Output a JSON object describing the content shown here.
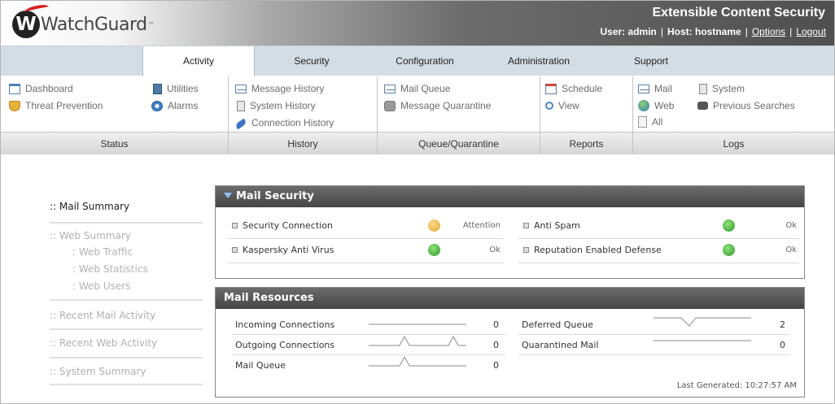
{
  "header": {
    "logo_text": "WatchGuard",
    "logo_tm": "™",
    "product": "Extensible Content Security",
    "user_label": "User:",
    "user": "admin",
    "host_label": "Host:",
    "host": "hostname",
    "options": "Options",
    "logout": "Logout",
    "separator": "|"
  },
  "tabs": [
    "Activity",
    "Security",
    "Configuration",
    "Administration",
    "Support"
  ],
  "active_tab": "Activity",
  "submenu": {
    "status": {
      "name": "Status",
      "items": [
        {
          "label": "Dashboard",
          "icon": "dashboard-icon"
        },
        {
          "label": "Threat Prevention",
          "icon": "shield-icon"
        },
        {
          "label": "Utilities",
          "icon": "utilities-icon"
        },
        {
          "label": "Alarms",
          "icon": "alarm-icon"
        }
      ]
    },
    "history": {
      "name": "History",
      "items": [
        {
          "label": "Message History",
          "icon": "envelope-icon"
        },
        {
          "label": "System History",
          "icon": "document-icon"
        },
        {
          "label": "Connection History",
          "icon": "plug-icon"
        }
      ]
    },
    "queue": {
      "name": "Queue/Quarantine",
      "items": [
        {
          "label": "Mail Queue",
          "icon": "envelope-icon"
        },
        {
          "label": "Message Quarantine",
          "icon": "lock-icon"
        }
      ]
    },
    "reports": {
      "name": "Reports",
      "items": [
        {
          "label": "Schedule",
          "icon": "calendar-icon"
        },
        {
          "label": "View",
          "icon": "magnifier-icon"
        }
      ]
    },
    "logs": {
      "name": "Logs",
      "items": [
        {
          "label": "Mail",
          "icon": "envelope-icon"
        },
        {
          "label": "Web",
          "icon": "globe-icon"
        },
        {
          "label": "All",
          "icon": "page-icon"
        },
        {
          "label": "System",
          "icon": "document-icon"
        },
        {
          "label": "Previous Searches",
          "icon": "binoculars-icon"
        }
      ]
    }
  },
  "left_nav": {
    "prefix": "::",
    "mail_summary": "Mail Summary",
    "web_summary": "Web Summary",
    "web_sub": [
      ": Web Traffic",
      ": Web Statistics",
      ": Web Users"
    ],
    "recent_mail": "Recent Mail Activity",
    "recent_web": "Recent Web Activity",
    "system_summary": "System Summary"
  },
  "mail_security": {
    "title": "Mail Security",
    "rows": [
      {
        "label": "Security Connection",
        "status": "Attention",
        "color": "#e4a934"
      },
      {
        "label": "Anti Spam",
        "status": "Ok",
        "color": "#2f9a2a"
      },
      {
        "label": "Kaspersky Anti Virus",
        "status": "Ok",
        "color": "#2f9a2a"
      },
      {
        "label": "Reputation Enabled Defense",
        "status": "Ok",
        "color": "#2f9a2a"
      }
    ]
  },
  "mail_resources": {
    "title": "Mail Resources",
    "rows": [
      {
        "label": "Incoming Connections",
        "value": "0"
      },
      {
        "label": "Outgoing Connections",
        "value": "0"
      },
      {
        "label": "Mail Queue",
        "value": "0"
      },
      {
        "label": "Deferred Queue",
        "value": "2"
      },
      {
        "label": "Quarantined Mail",
        "value": "0"
      }
    ],
    "last_generated": "Last Generated: 10:27:57 AM"
  },
  "colors": {
    "ok": "#2f9a2a",
    "attention": "#e4a934",
    "header_dark": "#4f4f4f",
    "tab_bar": "#d4dde4"
  }
}
